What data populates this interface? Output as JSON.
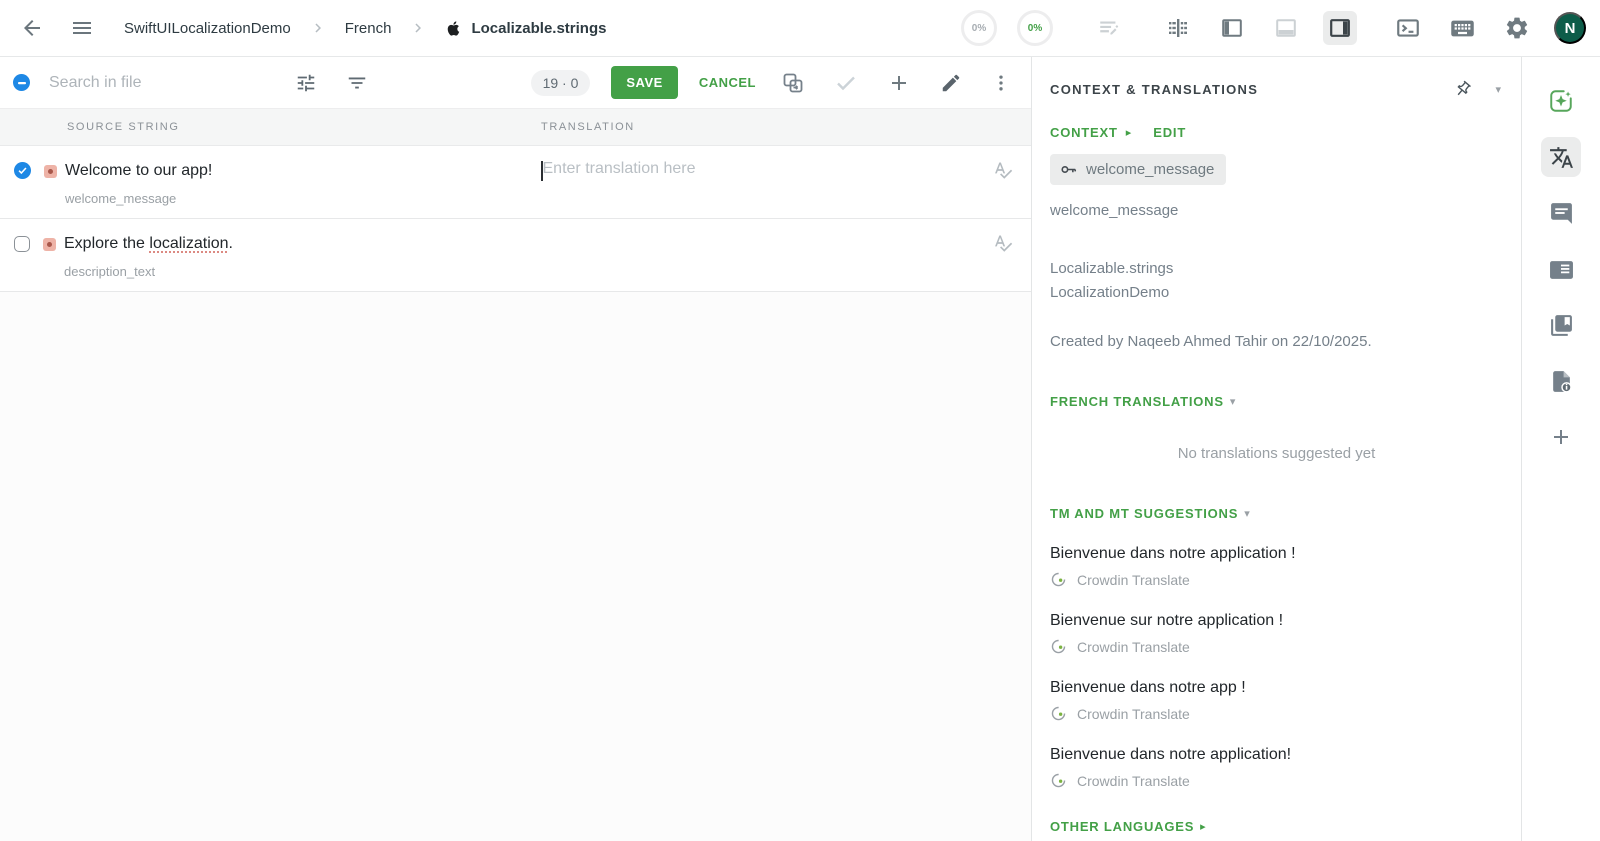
{
  "topbar": {
    "breadcrumb": {
      "project": "SwiftUILocalizationDemo",
      "language": "French",
      "file": "Localizable.strings"
    },
    "progress": {
      "first": "0%",
      "second": "0%"
    },
    "avatar_initial": "N"
  },
  "toolbar": {
    "search_placeholder": "Search in file",
    "counter": "19 · 0",
    "save_label": "SAVE",
    "cancel_label": "CANCEL"
  },
  "table": {
    "headers": {
      "source": "SOURCE STRING",
      "translation": "TRANSLATION"
    },
    "rows": [
      {
        "source": "Welcome to our app!",
        "key": "welcome_message",
        "translation_placeholder": "Enter translation here"
      },
      {
        "source_before": "Explore the ",
        "source_misspelled": "localization",
        "source_after": ".",
        "key": "description_text"
      }
    ]
  },
  "sidebar": {
    "title": "CONTEXT & TRANSLATIONS",
    "context_label": "CONTEXT",
    "edit_label": "EDIT",
    "key_chip": "welcome_message",
    "key_plain": "welcome_message",
    "file_name": "Localizable.strings",
    "project_name": "LocalizationDemo",
    "created_by": "Created by Naqeeb Ahmed Tahir on 22/10/2025.",
    "sections": {
      "french": "FRENCH TRANSLATIONS",
      "empty_message": "No translations suggested yet",
      "tm": "TM AND MT SUGGESTIONS",
      "other": "OTHER LANGUAGES"
    },
    "suggestions": [
      {
        "text": "Bienvenue dans notre application !",
        "source": "Crowdin Translate"
      },
      {
        "text": "Bienvenue sur notre application !",
        "source": "Crowdin Translate"
      },
      {
        "text": "Bienvenue dans notre app !",
        "source": "Crowdin Translate"
      },
      {
        "text": "Bienvenue dans notre application!",
        "source": "Crowdin Translate"
      }
    ]
  },
  "colors": {
    "accent_green": "#43a047",
    "accent_blue": "#1e88e5",
    "avatar_bg": "#0d5c49"
  }
}
